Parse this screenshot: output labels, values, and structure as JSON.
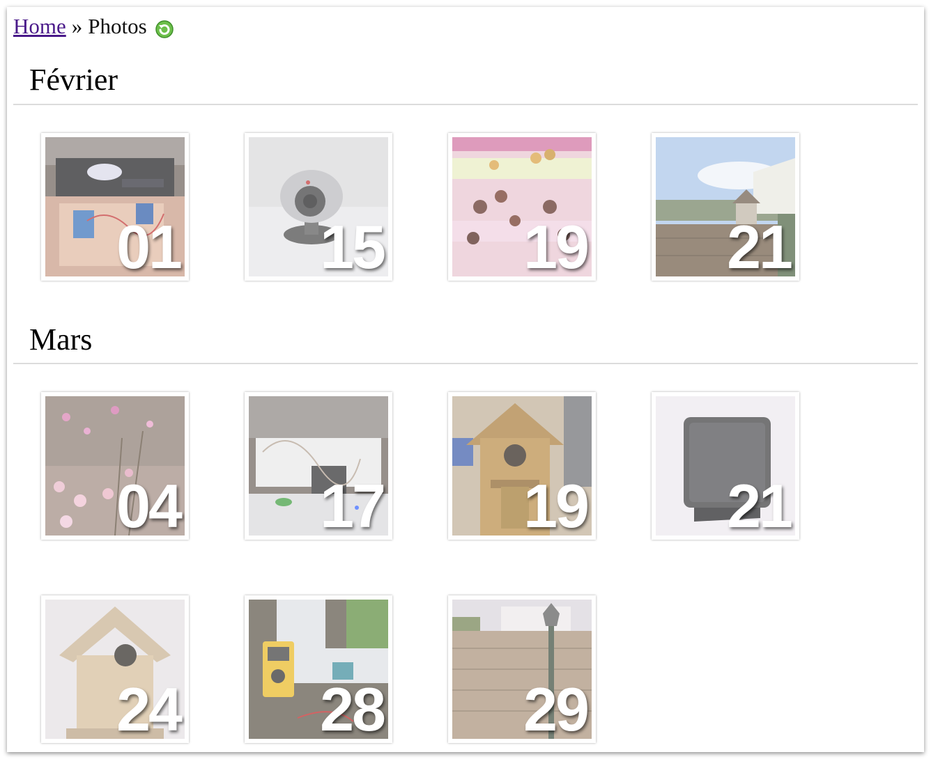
{
  "breadcrumb": {
    "home_label": "Home",
    "separator": "»",
    "current_label": "Photos",
    "refresh_icon": "refresh-icon",
    "refresh_color": "#5aae3a"
  },
  "sections": [
    {
      "title": "Février",
      "photos": [
        {
          "day": "01",
          "subject": "electronics box"
        },
        {
          "day": "15",
          "subject": "webcam"
        },
        {
          "day": "19",
          "subject": "cake pops"
        },
        {
          "day": "21",
          "subject": "garden house"
        }
      ]
    },
    {
      "title": "Mars",
      "photos": [
        {
          "day": "04",
          "subject": "flowers"
        },
        {
          "day": "17",
          "subject": "electronics"
        },
        {
          "day": "19",
          "subject": "birdhouse workshop"
        },
        {
          "day": "21",
          "subject": "speaker"
        },
        {
          "day": "24",
          "subject": "birdhouse"
        },
        {
          "day": "28",
          "subject": "multimeter"
        },
        {
          "day": "29",
          "subject": "fence lamp"
        }
      ]
    }
  ],
  "colors": {
    "link": "#4a1a8a",
    "rule": "#dcdcdc",
    "day_text": "#ffffff"
  }
}
